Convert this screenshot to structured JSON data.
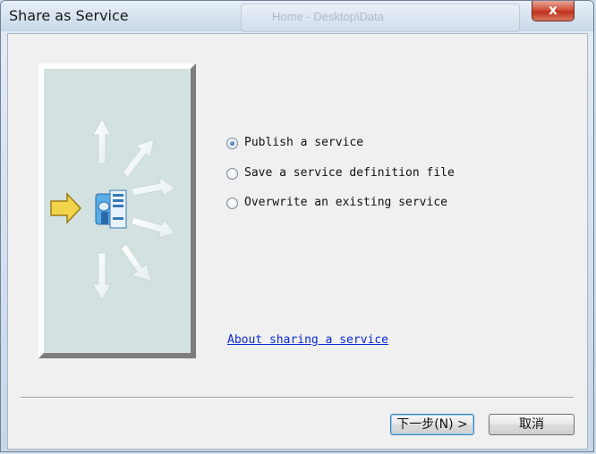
{
  "window": {
    "title": "Share as Service",
    "close_symbol": "x"
  },
  "background_window": {
    "title_fragment": "Home - Desktop\\Data"
  },
  "options": [
    {
      "label": "Publish a service",
      "selected": true
    },
    {
      "label": "Save a service definition file",
      "selected": false
    },
    {
      "label": "Overwrite an existing service",
      "selected": false
    }
  ],
  "link": {
    "label": "About sharing a service"
  },
  "buttons": {
    "next_label": "下一步(N) >",
    "cancel_label": "取消"
  },
  "colors": {
    "link": "#0a2bd6",
    "panel": "#d3e2e1",
    "arrow_yellow": "#f2d44b",
    "server_blue": "#4b9de0"
  },
  "icons": [
    "publish-arrow-icon",
    "service-server-icon",
    "distribution-arrows-icon"
  ]
}
